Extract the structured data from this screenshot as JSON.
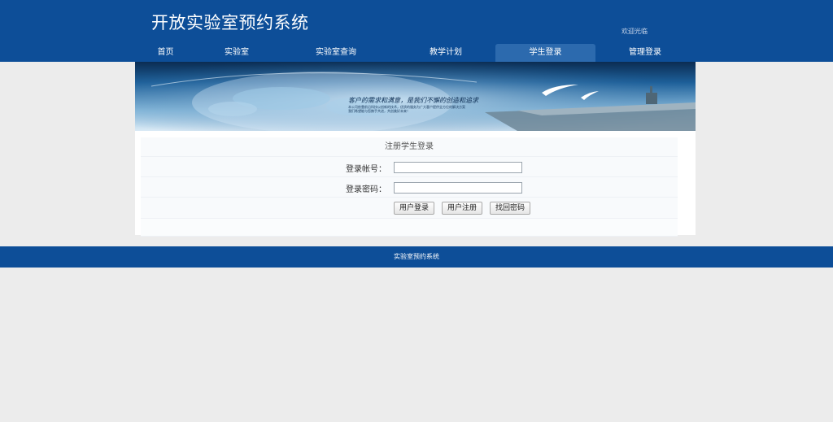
{
  "header": {
    "site_title": "开放实验室预约系统",
    "welcome_text": "欢迎光临"
  },
  "nav": {
    "items": [
      {
        "label": "首页"
      },
      {
        "label": "实验室"
      },
      {
        "label": "实验室查询"
      },
      {
        "label": "教学计划"
      },
      {
        "label": "学生登录"
      },
      {
        "label": "管理登录"
      }
    ],
    "active": "学生登录"
  },
  "banner": {
    "headline": "客户的需求和满意，是我们不懈的创造和追求",
    "subtext_1": "本公司依靠前沿科技以创新的技术，优质的服务为广大客户提供全方位的解决方案",
    "subtext_2": "我们希望能与您携手共进，共创美好未来！"
  },
  "login_form": {
    "title": "注册学生登录",
    "account_label": "登录帐号：",
    "account_value": "",
    "password_label": "登录密码：",
    "password_value": "",
    "login_button": "用户登录",
    "register_button": "用户注册",
    "recover_button": "找回密码"
  },
  "footer": {
    "text": "实验室预约系统"
  },
  "colors": {
    "primary_blue": "#0d4e98",
    "active_tab": "#2c6aae",
    "page_bg": "#ececec"
  }
}
